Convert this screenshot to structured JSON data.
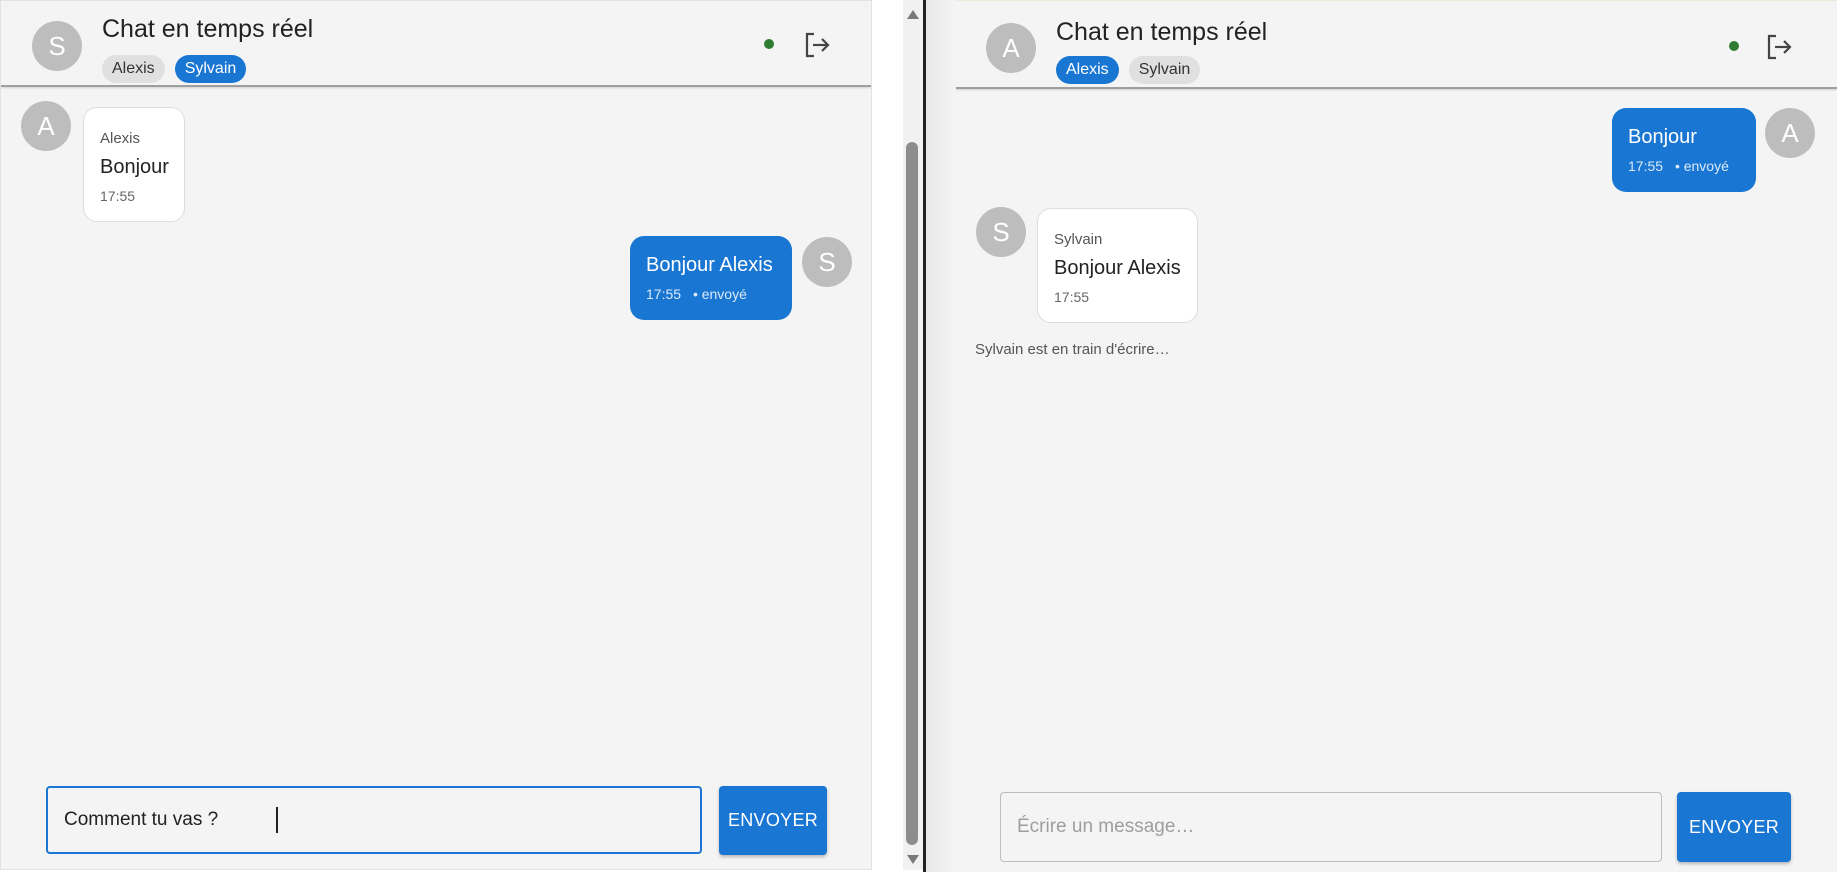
{
  "left_window": {
    "header": {
      "avatar_letter": "S",
      "title": "Chat en temps réel",
      "users": [
        "Alexis",
        "Sylvain"
      ],
      "online_color": "#2e7d32",
      "logout_icon": "logout-icon"
    },
    "messages": [
      {
        "direction": "in",
        "avatar": "A",
        "sender": "Alexis",
        "text": "Bonjour",
        "time": "17:55"
      },
      {
        "direction": "out",
        "avatar": "S",
        "text": "Bonjour Alexis",
        "time": "17:55",
        "status": "• envoyé"
      }
    ],
    "composer": {
      "value": "Comment tu vas ?",
      "send_label": "ENVOYER"
    }
  },
  "right_window": {
    "header": {
      "avatar_letter": "A",
      "title": "Chat en temps réel",
      "users": [
        "Alexis",
        "Sylvain"
      ],
      "online_color": "#2e7d32",
      "logout_icon": "logout-icon"
    },
    "messages": [
      {
        "direction": "out",
        "avatar": "A",
        "text": "Bonjour",
        "time": "17:55",
        "status": "• envoyé"
      },
      {
        "direction": "in",
        "avatar": "S",
        "sender": "Sylvain",
        "text": "Bonjour Alexis",
        "time": "17:55"
      }
    ],
    "typing_indicator": "Sylvain est en train d'écrire…",
    "composer": {
      "placeholder": "Écrire un message…",
      "send_label": "ENVOYER"
    }
  },
  "colors": {
    "accent": "#1976d2",
    "background": "#f4f4f4",
    "avatar": "#bdbdbd"
  }
}
